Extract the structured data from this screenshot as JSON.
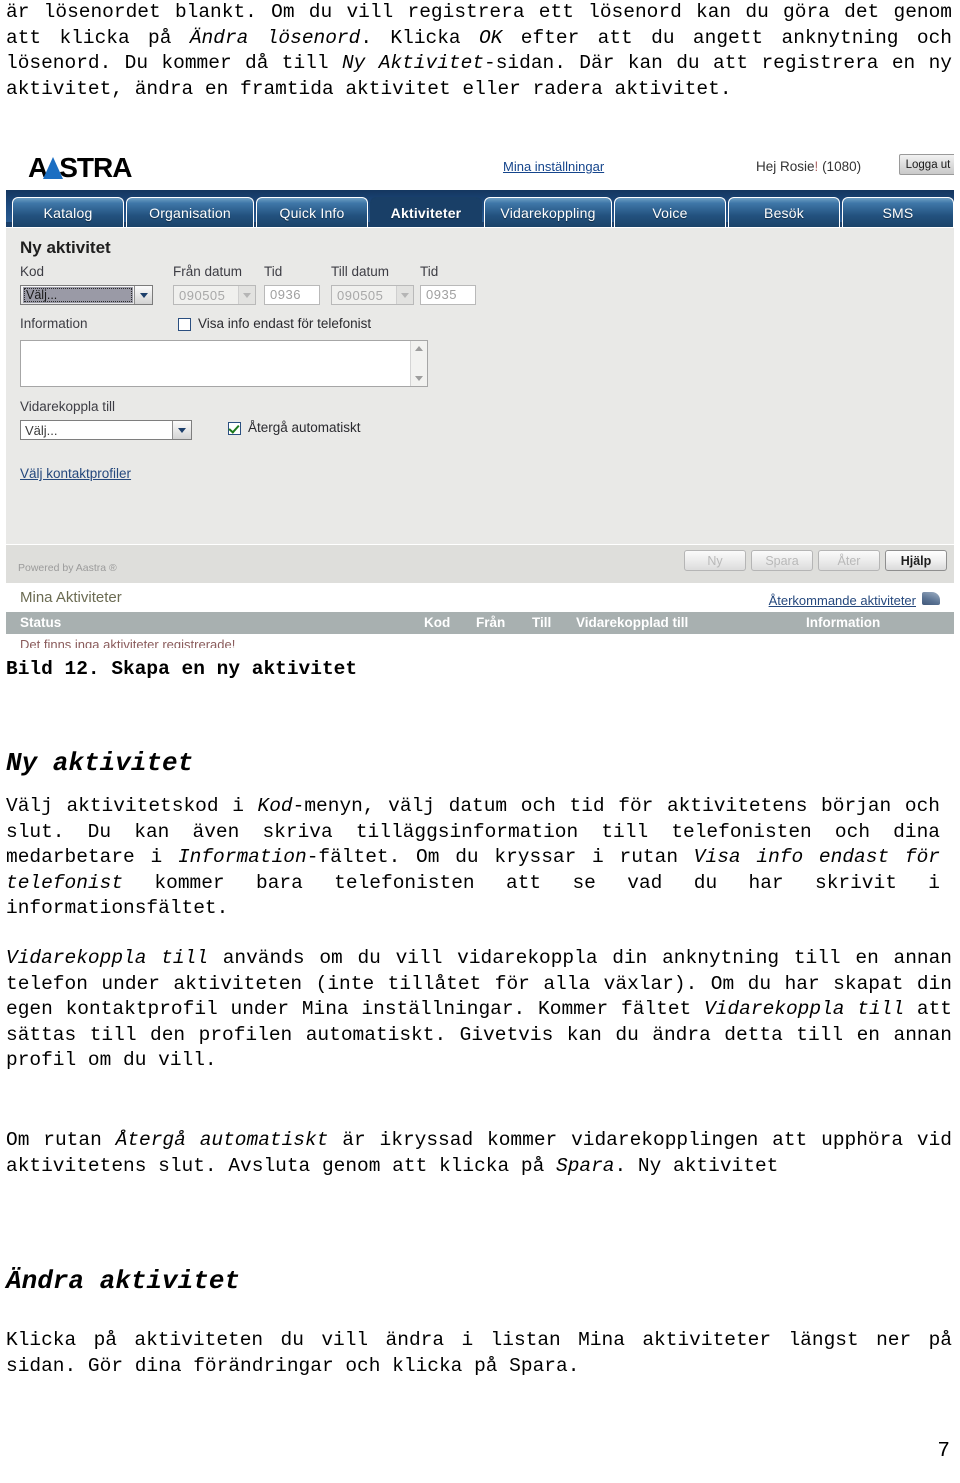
{
  "document": {
    "intro_paragraph": "är lösenordet blankt. Om du vill registrera ett lösenord kan du göra det genom att klicka på <em>Ändra lösenord</em>. Klicka <em>OK</em> efter att du angett anknytning och lösenord. Du kommer då till <em>Ny Aktivitet</em>-sidan. Där kan du att registrera en ny aktivitet, ändra en framtida aktivitet eller radera aktivitet.",
    "figure_caption": "Bild 12. Skapa en ny aktivitet",
    "heading_ny_aktivitet": "Ny aktivitet",
    "paragraph_ny_aktivitet": "Välj aktivitetskod i <em>Kod</em>-menyn, välj datum och tid för aktivitetens början och slut. Du kan även skriva tilläggsinformation till telefonisten och dina medarbetare i <em>Information</em>-fältet. Om du kryssar i rutan <em>Visa info endast för telefonist</em> kommer bara telefonisten att se vad du har skrivit i informationsfältet.",
    "paragraph_vidarekoppla": "<em>Vidarekoppla till</em> används om du vill vidarekoppla din anknytning till en annan telefon under aktiviteten (inte tillåtet för alla växlar). Om du har skapat din egen kontaktprofil under Mina inställningar. Kommer fältet <em>Vidarekoppla till</em> att sättas till den profilen automatiskt. Givetvis kan du ändra detta till en annan profil om du vill.",
    "paragraph_atergaa": "Om rutan <em>Återgå automatiskt</em> är ikryssad kommer vidarekopplingen att upphöra vid aktivitetens slut. Avsluta genom att klicka på <em>Spara</em>. Ny aktivitet",
    "heading_andra_aktivitet": "Ändra aktivitet",
    "paragraph_andra_aktivitet": "Klicka på aktiviteten du vill ändra i listan Mina aktiviteter längst ner på sidan. Gör dina förändringar och klicka på Spara.",
    "page_number": "7"
  },
  "app": {
    "header": {
      "logo_text_left": "A",
      "logo_text_right": "STRA",
      "settings_link": "Mina inställningar",
      "greeting": "Hej Rosie! (1080)",
      "greeting_name": "Hej Rosie",
      "greeting_ext": "(1080)",
      "logout_label": "Logga ut"
    },
    "tabs": [
      {
        "label": "Katalog",
        "active": false
      },
      {
        "label": "Organisation",
        "active": false
      },
      {
        "label": "Quick Info",
        "active": false
      },
      {
        "label": "Aktiviteter",
        "active": true
      },
      {
        "label": "Vidarekoppling",
        "active": false
      },
      {
        "label": "Voice",
        "active": false
      },
      {
        "label": "Besök",
        "active": false
      },
      {
        "label": "SMS",
        "active": false
      }
    ],
    "form": {
      "panel_title": "Ny aktivitet",
      "label_kod": "Kod",
      "kod_value": "Välj...",
      "label_fran_datum": "Från datum",
      "label_fran_tid": "Tid",
      "label_till_datum": "Till datum",
      "label_till_tid": "Tid",
      "fran_datum_value": "090505",
      "fran_tid_value": "0936",
      "till_datum_value": "090505",
      "till_tid_value": "0935",
      "label_information": "Information",
      "checkbox_visa_info_label": "Visa info endast för telefonist",
      "checkbox_visa_info_checked": false,
      "information_value": "",
      "label_vidarekoppla_till": "Vidarekoppla till",
      "vidarekoppla_value": "Välj...",
      "checkbox_atergaa_label": "Återgå automatiskt",
      "checkbox_atergaa_checked": true,
      "kontaktprofiler_link": "Välj kontaktprofiler"
    },
    "footer": {
      "powered_by": "Powered by Aastra ®",
      "buttons": [
        {
          "label": "Ny",
          "enabled": false
        },
        {
          "label": "Spara",
          "enabled": false
        },
        {
          "label": "Åter",
          "enabled": false
        },
        {
          "label": "Hjälp",
          "enabled": true
        }
      ]
    },
    "activities": {
      "title": "Mina Aktiviteter",
      "recurring_link": "Återkommande aktiviteter",
      "columns": [
        "Status",
        "Kod",
        "Från",
        "Till",
        "Vidarekopplad till",
        "Information"
      ],
      "empty_message": "Det finns inga aktiviteter registrerade!"
    }
  }
}
